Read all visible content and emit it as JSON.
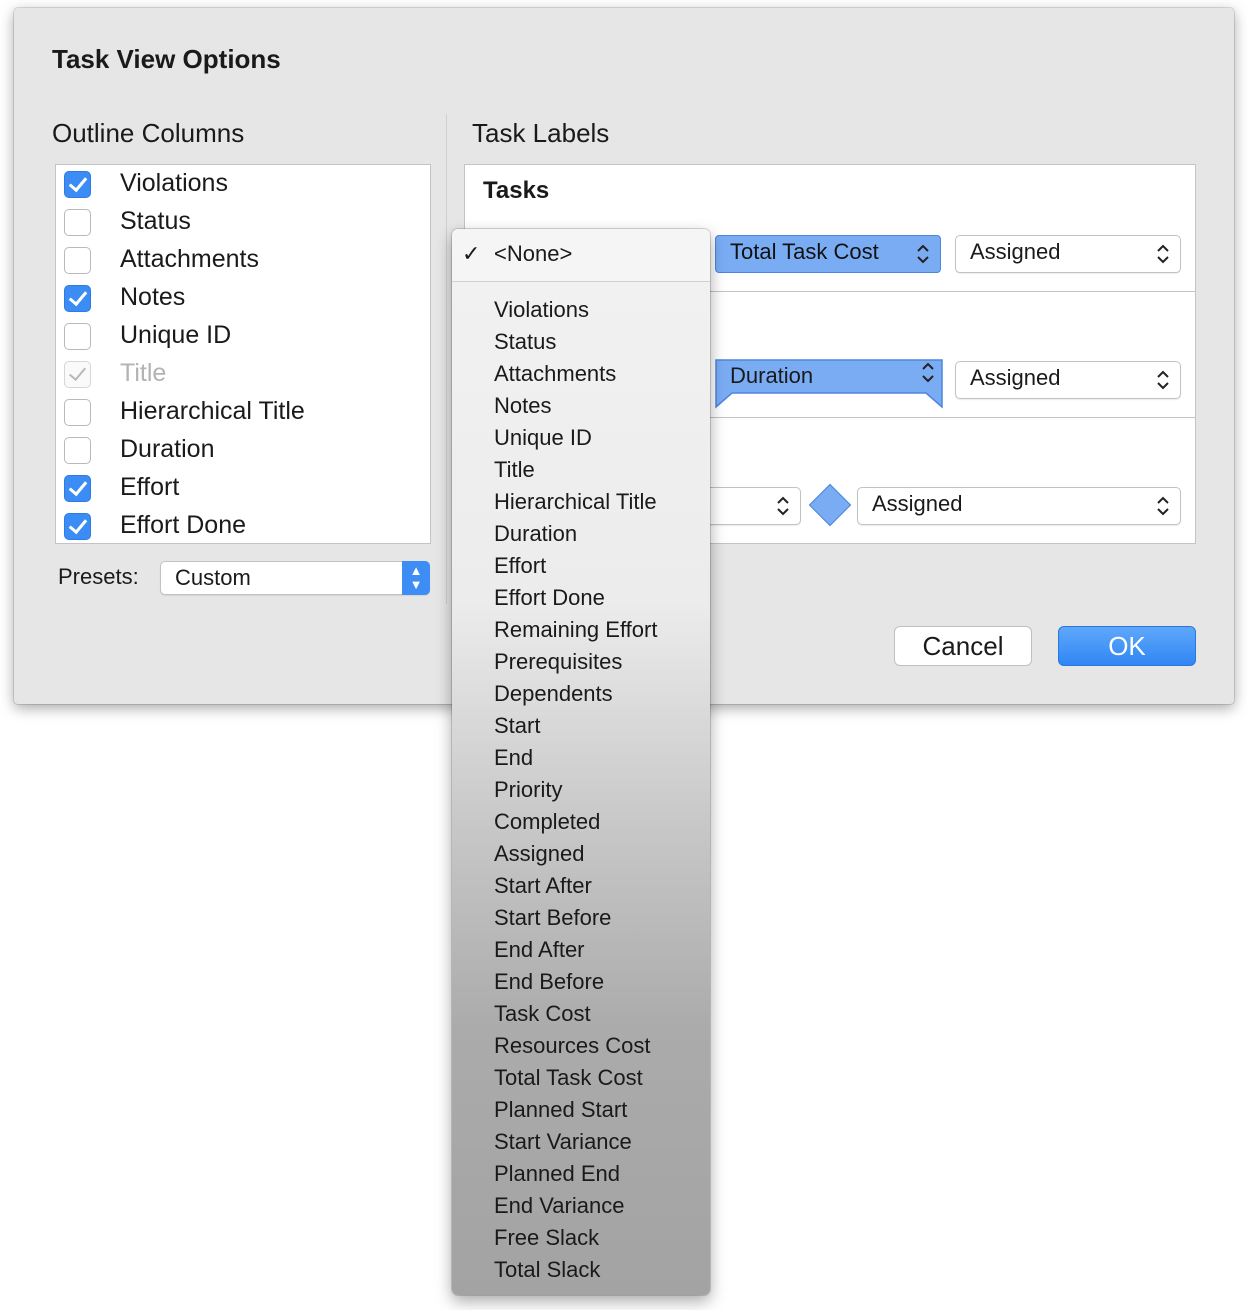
{
  "dialog": {
    "title": "Task View Options",
    "outline_title": "Outline Columns",
    "labels_title": "Task Labels"
  },
  "columns": [
    {
      "label": "Violations",
      "state": "checked"
    },
    {
      "label": "Status",
      "state": "unchecked"
    },
    {
      "label": "Attachments",
      "state": "unchecked"
    },
    {
      "label": "Notes",
      "state": "checked"
    },
    {
      "label": "Unique ID",
      "state": "unchecked"
    },
    {
      "label": "Title",
      "state": "disabled"
    },
    {
      "label": "Hierarchical Title",
      "state": "unchecked"
    },
    {
      "label": "Duration",
      "state": "unchecked"
    },
    {
      "label": "Effort",
      "state": "checked"
    },
    {
      "label": "Effort Done",
      "state": "checked"
    }
  ],
  "presets": {
    "label": "Presets:",
    "value": "Custom"
  },
  "labels": {
    "tasks_title": "Tasks",
    "row1_center": "Total Task Cost",
    "row1_right": "Assigned",
    "row2_center": "Duration",
    "row2_right": "Assigned",
    "row3_right": "Assigned"
  },
  "buttons": {
    "cancel": "Cancel",
    "ok": "OK"
  },
  "menu": {
    "check": "✓",
    "selected": "<None>",
    "items": [
      "Violations",
      "Status",
      "Attachments",
      "Notes",
      "Unique ID",
      "Title",
      "Hierarchical Title",
      "Duration",
      "Effort",
      "Effort Done",
      "Remaining Effort",
      "Prerequisites",
      "Dependents",
      "Start",
      "End",
      "Priority",
      "Completed",
      "Assigned",
      "Start After",
      "Start Before",
      "End After",
      "End Before",
      "Task Cost",
      "Resources Cost",
      "Total Task Cost",
      "Planned Start",
      "Start Variance",
      "Planned End",
      "End Variance",
      "Free Slack",
      "Total Slack"
    ]
  },
  "colors": {
    "accent": "#3b8cf5",
    "label_fill": "#7aacf4"
  }
}
